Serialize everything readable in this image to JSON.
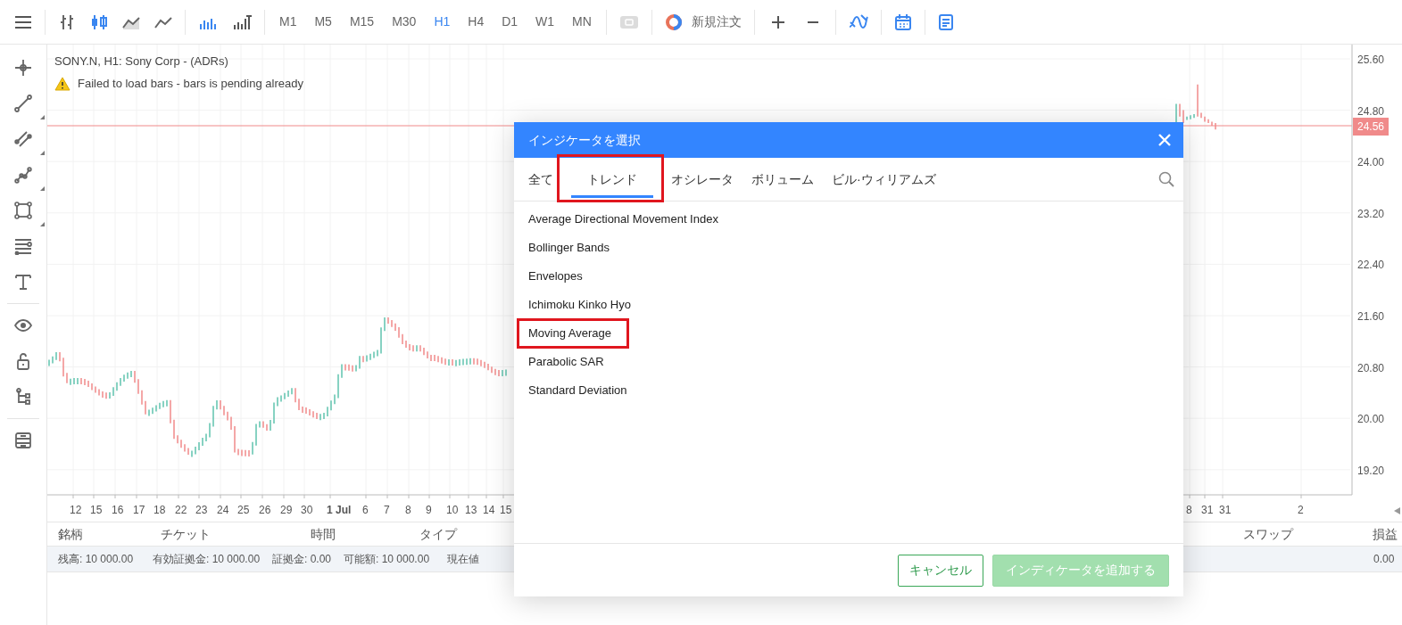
{
  "toolbar": {
    "chart_types": [
      {
        "kind": "bars",
        "selected": false
      },
      {
        "kind": "candles",
        "selected": true
      },
      {
        "kind": "area",
        "selected": false
      },
      {
        "kind": "line",
        "selected": false
      }
    ],
    "volume_types": [
      {
        "kind": "volume",
        "selected": true
      },
      {
        "kind": "volume-bars",
        "selected": false
      }
    ],
    "timeframes": [
      {
        "label": "M1",
        "selected": false
      },
      {
        "label": "M5",
        "selected": false
      },
      {
        "label": "M15",
        "selected": false
      },
      {
        "label": "M30",
        "selected": false
      },
      {
        "label": "H1",
        "selected": true
      },
      {
        "label": "H4",
        "selected": false
      },
      {
        "label": "D1",
        "selected": false
      },
      {
        "label": "W1",
        "selected": false
      },
      {
        "label": "MN",
        "selected": false
      }
    ],
    "actions": [
      {
        "kind": "sync",
        "disabled": true
      },
      {
        "kind": "order",
        "label": "新規注文"
      },
      {
        "kind": "zoom-in"
      },
      {
        "kind": "zoom-out"
      },
      {
        "kind": "indicators"
      },
      {
        "kind": "calendar"
      },
      {
        "kind": "report"
      }
    ]
  },
  "drawing_tools": [
    {
      "kind": "crosshair",
      "submenu": false
    },
    {
      "kind": "trend-line",
      "submenu": true
    },
    {
      "kind": "channel",
      "submenu": true
    },
    {
      "kind": "polyline",
      "submenu": true
    },
    {
      "kind": "rectangle",
      "submenu": true
    },
    {
      "kind": "fibonacci",
      "submenu": false
    },
    {
      "kind": "text",
      "submenu": false
    },
    {
      "kind": "divider"
    },
    {
      "kind": "eye",
      "submenu": false
    },
    {
      "kind": "lock",
      "submenu": false
    },
    {
      "kind": "tree",
      "submenu": false
    },
    {
      "kind": "divider"
    },
    {
      "kind": "stack",
      "submenu": false
    }
  ],
  "chart": {
    "title": "SONY.N, H1: Sony Corp - (ADRs)",
    "warning": "Failed to load bars - bars is pending already",
    "price_labels": [
      "25.60",
      "24.80",
      "24.00",
      "23.20",
      "22.40",
      "21.60",
      "20.80",
      "20.00",
      "19.20"
    ],
    "current_price": "24.56",
    "time_labels": [
      {
        "label": "12",
        "bold": false
      },
      {
        "label": "15",
        "bold": false
      },
      {
        "label": "16",
        "bold": false
      },
      {
        "label": "17",
        "bold": false
      },
      {
        "label": "18",
        "bold": false
      },
      {
        "label": "22",
        "bold": false
      },
      {
        "label": "23",
        "bold": false
      },
      {
        "label": "24",
        "bold": false
      },
      {
        "label": "25",
        "bold": false
      },
      {
        "label": "26",
        "bold": false
      },
      {
        "label": "29",
        "bold": false
      },
      {
        "label": "30",
        "bold": false
      },
      {
        "label": "1 Jul",
        "bold": true
      },
      {
        "label": "6",
        "bold": false
      },
      {
        "label": "7",
        "bold": false
      },
      {
        "label": "8",
        "bold": false
      },
      {
        "label": "9",
        "bold": false
      },
      {
        "label": "10",
        "bold": false
      },
      {
        "label": "13",
        "bold": false
      },
      {
        "label": "14",
        "bold": false
      },
      {
        "label": "15",
        "bold": false
      },
      {
        "label": "8",
        "bold": false
      },
      {
        "label": "31",
        "bold": false
      },
      {
        "label": "31",
        "bold": false
      },
      {
        "label": "2",
        "bold": false
      }
    ]
  },
  "positions_table": {
    "columns": [
      "銘柄",
      "チケット",
      "時間",
      "タイプ",
      "スワップ",
      "損益"
    ],
    "summary": [
      "残高: 10 000.00",
      "有効証拠金: 10 000.00",
      "証拠金: 0.00",
      "可能額: 10 000.00",
      "現在値"
    ],
    "summary_total": "0.00"
  },
  "dialog": {
    "title": "インジケータを選択",
    "tabs": [
      {
        "label": "全て",
        "selected": false,
        "highlighted": false
      },
      {
        "label": "トレンド",
        "selected": true,
        "highlighted": true
      },
      {
        "label": "オシレータ",
        "selected": false,
        "highlighted": false
      },
      {
        "label": "ボリューム",
        "selected": false,
        "highlighted": false
      },
      {
        "label": "ビル·ウィリアムズ",
        "selected": false,
        "highlighted": false
      }
    ],
    "items": [
      {
        "label": "Average Directional Movement Index",
        "highlighted": false
      },
      {
        "label": "Bollinger Bands",
        "highlighted": false
      },
      {
        "label": "Envelopes",
        "highlighted": false
      },
      {
        "label": "Ichimoku Kinko Hyo",
        "highlighted": false
      },
      {
        "label": "Moving Average",
        "highlighted": true
      },
      {
        "label": "Parabolic SAR",
        "highlighted": false
      },
      {
        "label": "Standard Deviation",
        "highlighted": false
      }
    ],
    "buttons": [
      {
        "kind": "cancel",
        "label": "キャンセル",
        "disabled": false
      },
      {
        "kind": "add",
        "label": "インディケータを追加する",
        "disabled": true
      }
    ]
  }
}
